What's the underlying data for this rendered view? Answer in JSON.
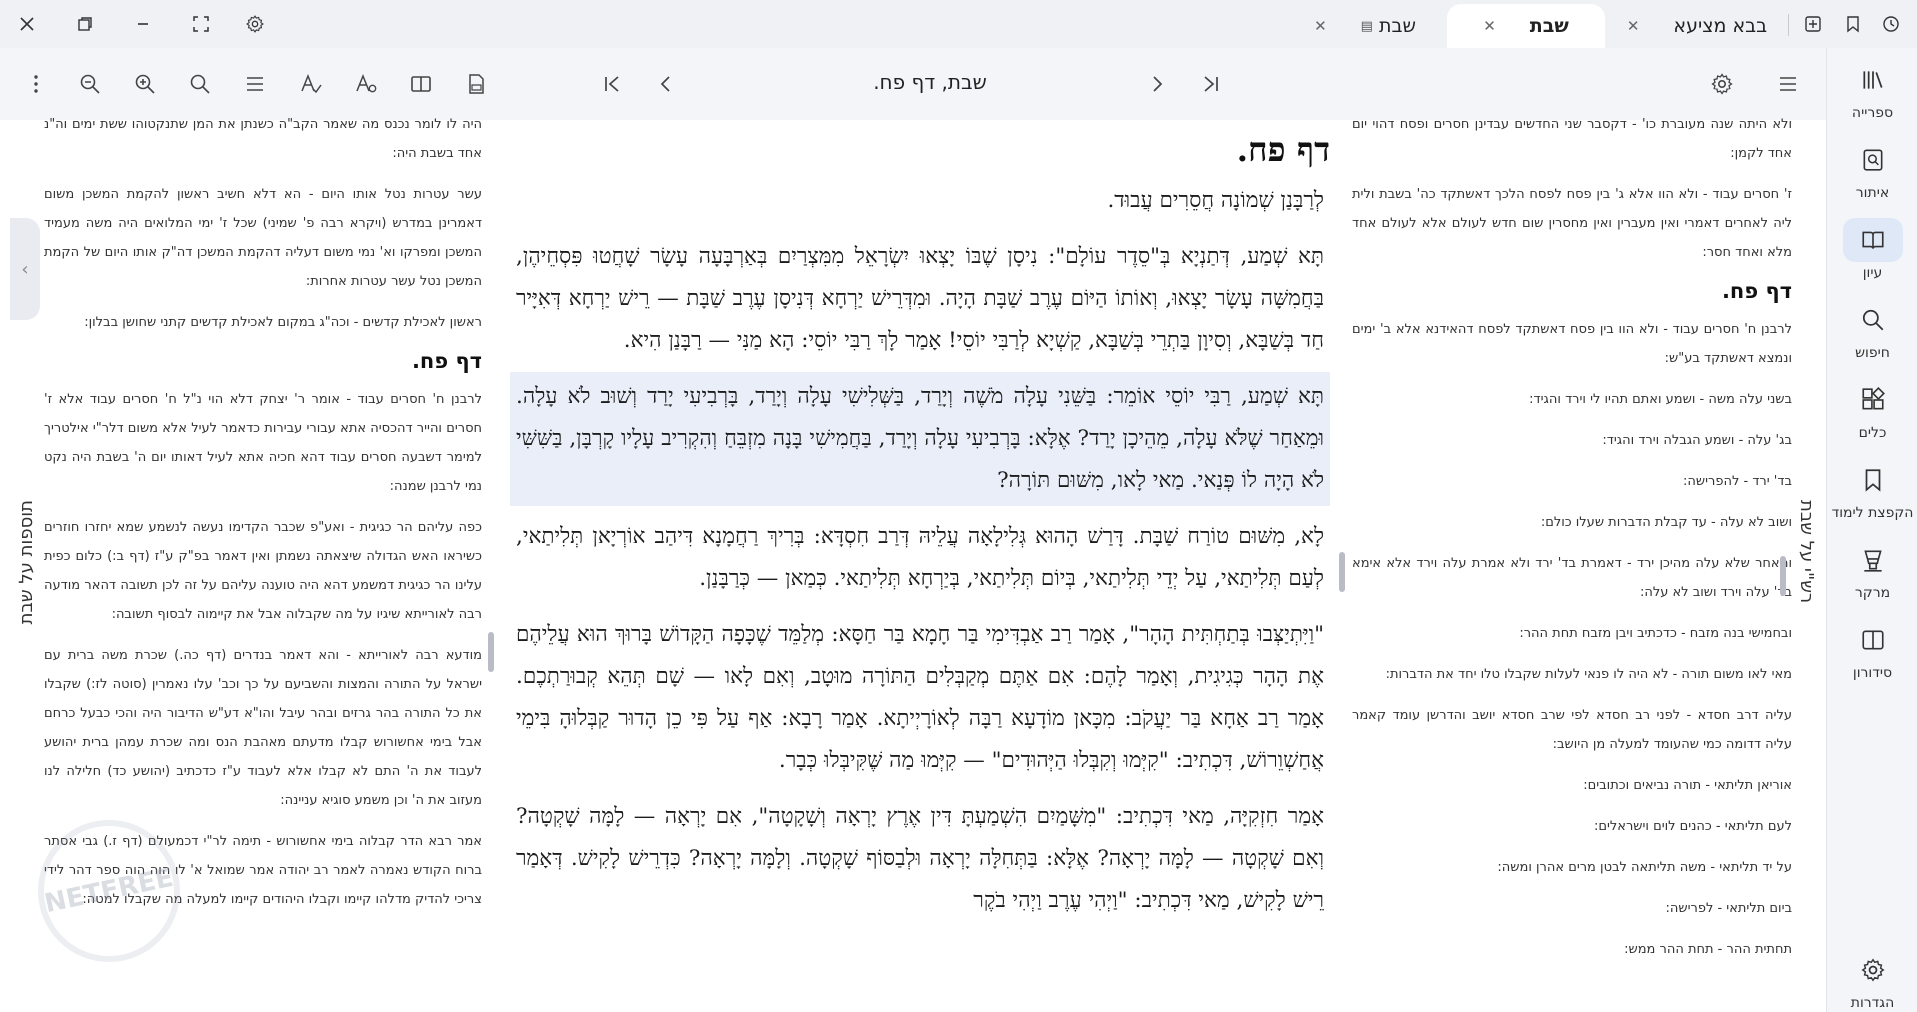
{
  "tabs": [
    {
      "label": "בבא מציעא",
      "active": false
    },
    {
      "label": "שבת",
      "active": true
    },
    {
      "label": "שבת",
      "active": false,
      "icon": "pdf-icon"
    }
  ],
  "document_title": "שבת, דף פח.",
  "nav": [
    {
      "label": "ספרייה",
      "icon": "library-icon"
    },
    {
      "label": "איתור",
      "icon": "locate-icon"
    },
    {
      "label": "עיון",
      "icon": "book-open-icon",
      "active": true
    },
    {
      "label": "חיפוש",
      "icon": "search-icon"
    },
    {
      "label": "כלים",
      "icon": "tools-icon"
    },
    {
      "label": "הקפצת לימוד",
      "icon": "bookmark-icon"
    },
    {
      "label": "מרקר",
      "icon": "marker-icon"
    },
    {
      "label": "סידורון",
      "icon": "siddur-icon"
    },
    {
      "label": "הגדרות",
      "icon": "gear-icon"
    }
  ],
  "pane_labels": {
    "rashi": "רש\"י על שבת",
    "tosfot": "תוספות על שבת"
  },
  "watermark": "NETFREE",
  "main": {
    "heading": "דף פח.",
    "paragraphs": [
      "לְרַבָּנַן שְׁמוֹנָה חֲסֵרִים עֲבוּד.",
      "תָּא שְׁמַע, דְּתַנְיָא בְּ\"סֵדֶר עוֹלָם\": נִיסָן שֶׁבּוֹ יָצְאוּ יִשְׂרָאֵל מִמִּצְרַיִם בְּאַרְבָּעָה עָשָׂר שָׁחֲטוּ פִּסְחֵיהֶן, בַּחֲמִשָּׁה עָשָׂר יָצְאוּ, וְאוֹתוֹ הַיּוֹם עֶרֶב שַׁבָּת הָיָה. וּמִדְּרֵישׁ יַרְחָא דְּנִיסָן עֶרֶב שַׁבָּת — רֵישׁ יַרְחָא דְּאִיָּיר חַד בְּשַׁבָּא, וְסִיוָן בַּתְרֵי בְּשַׁבָּא, קַשְׁיָא לְרַבִּי יוֹסֵי! אָמַר לָךְ רַבִּי יוֹסֵי: הָא מַנִּי — רַבָּנַן הִיא.",
      "תָּא שְׁמַע, רַבִּי יוֹסֵי אוֹמֵר: בַּשֵּׁנִי עָלָה מֹשֶׁה וְיָרַד, בַּשְּׁלִישִׁי עָלָה וְיָרַד, בָּרְבִיעִי יָרַד וְשׁוּב לֹא עָלָה. וּמֵאַחַר שֶׁלֹּא עָלָה, מֵהֵיכָן יָרַד? אֶלָּא: בָּרְבִיעִי עָלָה וְיָרַד, בַּחֲמִישִׁי בָּנָה מִזְבֵּחַ וְהִקְרִיב עָלָיו קָרְבָּן, בַּשִּׁשִּׁי לֹא הָיָה לוֹ פְּנַאי. מַאי לָאו, מִשּׁוּם תּוֹרָה?",
      "לָא, מִשּׁוּם טוֹרַח שַׁבָּת. דָּרַשׁ הָהוּא גְּלִילָאָה עֲלֵיהּ דְּרַב חִסְדָּא: בְּרִיךְ רַחֲמָנָא דִּיהַב אוֹרְיָאן תְּלִיתַאי, לְעַם תְּלִיתַאי, עַל יְדֵי תְּלִיתַאי, בְּיוֹם תְּלִיתַאי, בְּיַרְחָא תְּלִיתַאי. כְּמַאן — כְּרַבָּנַן.",
      "\"וַיִּתְיַצְּבוּ בְּתַחְתִּית הָהָר\", אָמַר רַב אַבְדִּימִי בַּר חָמָא בַּר חַסָּא: מְלַמֵּד שֶׁכָּפָה הַקָּדוֹשׁ בָּרוּךְ הוּא עֲלֵיהֶם אֶת הָהָר כְּגִיגִית, וְאָמַר לָהֶם: אִם אַתֶּם מְקַבְּלִים הַתּוֹרָה מוּטָב, וְאִם לָאו — שָׁם תְּהֵא קְבוּרַתְכֶם. אָמַר רַב אַחָא בַּר יַעֲקֹב: מִכָּאן מוֹדָעָא רַבָּה לְאוֹרָיְיתָא. אָמַר רָבָא: אַף עַל פִּי כֵן הָדוּר קַבְּלוּהָ בִּימֵי אֲחַשְׁוֵרוֹשׁ, דִּכְתִיב: \"קִיְּמוּ וְקִבְּלוּ הַיְּהוּדִים\" — קִיְּמוּ מַה שֶּׁקִּיבְּלוּ כְּבָר.",
      "אָמַר חִזְקִיָּה, מַאי דִּכְתִיב: \"מִשָּׁמַיִם הִשְׁמַעְתָּ דִּין אֶרֶץ יָרְאָה וְשָׁקָטָה\", אִם יָרְאָה — לָמָּה שָׁקְטָה? וְאִם שָׁקְטָה — לָמָּה יָרְאָה? אֶלָּא: בַּתְּחִלָּה יָרְאָה וּלְבַסּוֹף שָׁקְטָה. וְלָמָּה יָרְאָה? כִּדְרֵישׁ לָקִישׁ. דְּאָמַר רֵישׁ לָקִישׁ, מַאי דִּכְתִיב: \"וַיְהִי עֶרֶב וַיְהִי בֹקֶר"
    ]
  },
  "rashi": {
    "top": [
      "ולא היתה שנה מעוברת כו' - דקסבר שני החדשים עבדינן חסרים ופסח דהוי יום אחד לקמן:",
      "ז' חסרים עבוד - ולא הוו אלא ג' בין פסח לפסח הלכך דאשתקד כה' בשבת ולית ליה לאחרים דאמרי ואין מעברין ואין מחסרין שום חדש לעולם אלא לעולם אחד מלא ואחד חסר:"
    ],
    "heading": "דף פח.",
    "items": [
      "לרבנן ח' חסרים עבוד - ולא הוו בין פסח דאשתקד לפסח דהאידנא אלא ב' ימים ונמצא דאשתקד בע\"ש:",
      "בשני עלה משה - ושמע ואתם תהיו לי וירד והגיד:",
      "בג' עלה - ושמע הגבלה וירד והגיד:",
      "בד' ירד - להפרישה:",
      "ושוב לא עלה - עד קבלת הדברות שעלו כולם:",
      "ומאחר שלא עלה מהיכן ירד - דאמרת בד' ירד ולא אמרת עלה וירד אלא אימא בד' עלה וירד ושוב לא עלה:",
      "ובחמישי בנה מזבח - כדכתיב ויבן מזבח תחת ההר:",
      "מאי לאו משום תורה - לא היה לו פנאי לעלות שקבלו טלו יחד את הדברות:",
      "עליה דרב חסדא - לפני רב חסדא לפי שרב חסדא יושב והדרשן עומד קאמר עליה דדומה כמי שהעומד למעלה מן היושב:",
      "אוריאן תליתאי - תורה נביאים וכתובים:",
      "לעם תליתאי - כהנים לוים וישראלים:",
      "על יד תליתאי - משה תליתאה לבטן מרים אהרן ומשה:",
      "ביום תליתאי - לפרישה:",
      "תחתית ההר - תחת ההר ממש:"
    ]
  },
  "tosfot": {
    "top": [
      "היה לו לומר נכנס מה שאמר הקב\"ה כשנתן את המן שתנקטוהו ששת ימים וה\"נ אחד בשבת היה:",
      "עשר עטרות נטל אותו היום - הא דלא חשיב ראשון להקמת המשכן משום דאמרינן במדרש (ויקרא רבה פ' שמיני) שכל ז' ימי המלואים היה משה מעמיד המשכן ומפרקו וא' נמי משום דעליה דהקמת המשכן דה\"ק אותו היום של הקמת המשכן נטל עשר עטרות אחרות:",
      "ראשון לאכילת קדשים - וכה\"ג במקום לאכילת קדשים קתני שחושן בבלון:"
    ],
    "heading": "דף פח.",
    "items": [
      "לרבנן ח' חסרים עבוד - אומר ר' יצחק דלא הוי נ\"ל ח' חסרים עבוד אלא ז' חסרים והייר דהכסיה אתא עבורי עבירות כדאמר לעיל אלא משום דלר\"י אילטריך למימר דשבעה חסרים עבוד דהא חכיה אתא לעיל דאותו יום ה' בשבת היה נקט נמי לרבנן שמנה:",
      "כפה עליהם הר כגיגית - ואע\"פ שכבר הקדימו נעשה לנשמע שמא יחזרו חוזרים כשיראו האש הגדולה שיצאתה נשמתן ואין דאמר בפ\"ק ע\"ז (דף ב:) כלום כפית עלינו הר כגיגית דמשמע דהא היה טוענה עליהם על זה לכן תשובה דהאר מודעה רבה לאורייתא שיגיו על מה שקבלוה אבל את קיימוה לבסוף תשובה:",
      "מודעא רבה לאורייתא - והא דאמר בנדרים (דף כה.) שכרת משה ברית עם ישראל על התורה והמצות והשביעם על כך וכב' עלו נאמרין (סוטה לז:) שקבלו את כל התורה בהר גרזים ובהר עיבל והו\"א דע\"ש הדיבור היה והכי כבעל כרחם אבל בימי אחשורוש קבלו מדעתם מאהבת הנס ומה שכרת עמהן ברית יהושע לעבוד את ה' התם לא קבלו אלא לעבוד ע\"ז כדכתיב (יהושע כד) חלילה לנו מעזוב את ה' וכן משמע סוגיא עניינה:",
      "אמר רבא הדר קבלוה בימי אחשורוש - תימה לר\"י דכמעולם (דף ז.) גבי אסתר ברוח הקודש נאמרה לאמר רב יהודה אמר שמואל א' לו הוה הוה ספר דהר לידי צריכי להדיק מדלהו קיימו וקבלו היהודים קיימו למעלה מה שקבלו למטה:"
    ]
  }
}
